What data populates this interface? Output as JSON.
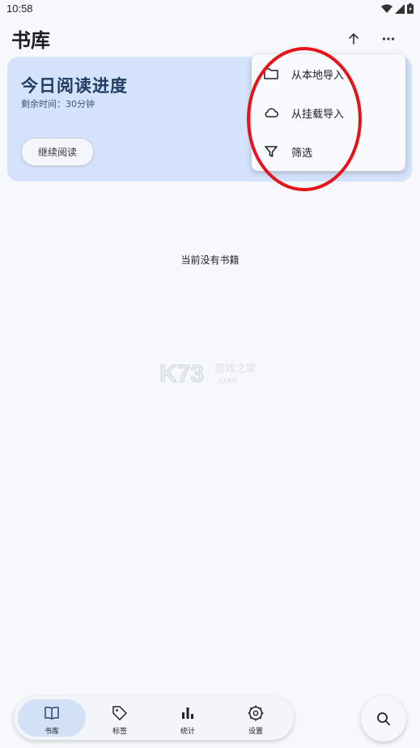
{
  "status_bar": {
    "time": "10:58"
  },
  "app_bar": {
    "title": "书库",
    "sort_icon": "arrow-up-icon",
    "more_icon": "more-horizontal-icon"
  },
  "progress_card": {
    "title": "今日阅读进度",
    "remaining": "剩余时间：30分钟",
    "continue_label": "继续阅读"
  },
  "menu": {
    "items": [
      {
        "label": "从本地导入",
        "icon": "folder-icon"
      },
      {
        "label": "从挂载导入",
        "icon": "cloud-icon"
      },
      {
        "label": "筛选",
        "icon": "filter-icon"
      }
    ]
  },
  "empty_state": {
    "text": "当前没有书籍"
  },
  "watermark": {
    "text": "K73 游戏之家 .com"
  },
  "bottom_nav": {
    "items": [
      {
        "label": "书库",
        "icon": "book-icon",
        "active": true
      },
      {
        "label": "标签",
        "icon": "tag-icon",
        "active": false
      },
      {
        "label": "统计",
        "icon": "bar-chart-icon",
        "active": false
      },
      {
        "label": "设置",
        "icon": "gear-icon",
        "active": false
      }
    ]
  },
  "search_fab": {
    "icon": "search-icon"
  },
  "colors": {
    "accent": "#d4e3fb",
    "card_title": "#1f3c63",
    "annotation": "#e5141b"
  }
}
